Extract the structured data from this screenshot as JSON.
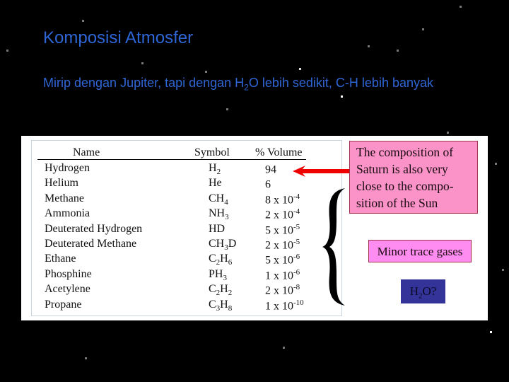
{
  "slide": {
    "title": "Komposisi Atmosfer",
    "subtitle_parts": {
      "before": "Mirip dengan Jupiter, tapi dengan H",
      "sub": "2",
      "after": "O lebih sedikit, C-H lebih banyak"
    }
  },
  "table": {
    "headers": {
      "name": "Name",
      "symbol": "Symbol",
      "volume": "% Volume"
    },
    "rows": [
      {
        "name": "Hydrogen",
        "symbol": [
          [
            "H",
            ""
          ],
          [
            "2",
            "sub"
          ]
        ],
        "mantissa": "94",
        "exponent": ""
      },
      {
        "name": "Helium",
        "symbol": [
          [
            "He",
            ""
          ]
        ],
        "mantissa": "6",
        "exponent": ""
      },
      {
        "name": "Methane",
        "symbol": [
          [
            "CH",
            ""
          ],
          [
            "4",
            "sub"
          ]
        ],
        "mantissa": "8 x 10",
        "exponent": "-4"
      },
      {
        "name": "Ammonia",
        "symbol": [
          [
            "NH",
            ""
          ],
          [
            "3",
            "sub"
          ]
        ],
        "mantissa": "2 x 10",
        "exponent": "-4"
      },
      {
        "name": "Deuterated Hydrogen",
        "symbol": [
          [
            "HD",
            ""
          ]
        ],
        "mantissa": "5 x 10",
        "exponent": "-5"
      },
      {
        "name": "Deuterated Methane",
        "symbol": [
          [
            "CH",
            ""
          ],
          [
            "3",
            "sub"
          ],
          [
            "D",
            ""
          ]
        ],
        "mantissa": "2 x 10",
        "exponent": "-5"
      },
      {
        "name": "Ethane",
        "symbol": [
          [
            "C",
            ""
          ],
          [
            "2",
            "sub"
          ],
          [
            "H",
            ""
          ],
          [
            "6",
            "sub"
          ]
        ],
        "mantissa": "5 x 10",
        "exponent": "-6"
      },
      {
        "name": "Phosphine",
        "symbol": [
          [
            "PH",
            ""
          ],
          [
            "3",
            "sub"
          ]
        ],
        "mantissa": "1 x 10",
        "exponent": "-6"
      },
      {
        "name": "Acetylene",
        "symbol": [
          [
            "C",
            ""
          ],
          [
            "2",
            "sub"
          ],
          [
            "H",
            ""
          ],
          [
            "2",
            "sub"
          ]
        ],
        "mantissa": "2 x 10",
        "exponent": "-8"
      },
      {
        "name": "Propane",
        "symbol": [
          [
            "C",
            ""
          ],
          [
            "3",
            "sub"
          ],
          [
            "H",
            ""
          ],
          [
            "8",
            "sub"
          ]
        ],
        "mantissa": "1 x 10",
        "exponent": "-10"
      }
    ]
  },
  "callouts": {
    "sun_note": "The composition of Saturn is also very close to the compo-sition of the Sun",
    "sun_note_lines": [
      "The composition of",
      "Saturn is also very",
      "close to the compo-",
      "sition of the Sun"
    ],
    "trace_label": "Minor trace gases",
    "water_label": {
      "before": "H",
      "sub": "2",
      "after": "O?"
    }
  },
  "colors": {
    "title": "#2f66d6",
    "sun_note_bg": "#fb93c8",
    "trace_bg": "#ff8cf0",
    "water_bg": "#333399",
    "arrow": "#ee0000"
  }
}
